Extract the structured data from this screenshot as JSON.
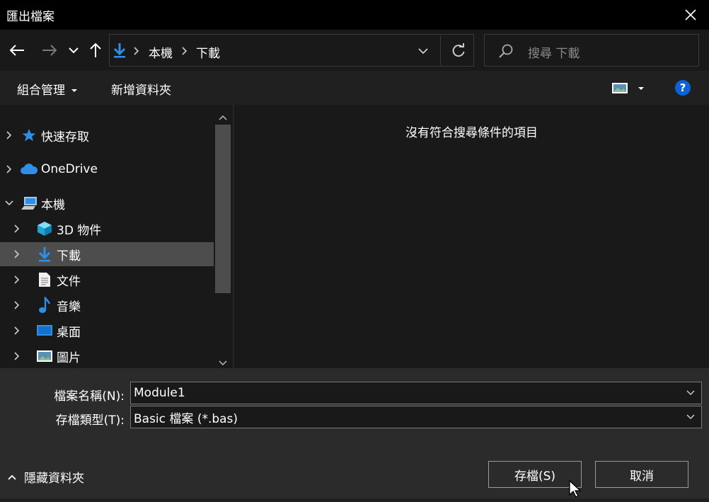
{
  "window": {
    "title": "匯出檔案"
  },
  "address": {
    "crumbs": [
      "本機",
      "下載"
    ]
  },
  "search": {
    "placeholder": "搜尋 下載"
  },
  "toolbar": {
    "organize_label": "組合管理",
    "new_folder_label": "新增資料夾",
    "help_label": "?"
  },
  "nav": {
    "items": [
      {
        "label": "快速存取",
        "icon": "star-icon"
      },
      {
        "label": "OneDrive",
        "icon": "cloud-icon"
      },
      {
        "label": "本機",
        "icon": "computer-icon"
      },
      {
        "label": "3D 物件",
        "icon": "cube-icon"
      },
      {
        "label": "下載",
        "icon": "download-icon",
        "selected": true
      },
      {
        "label": "文件",
        "icon": "document-icon"
      },
      {
        "label": "音樂",
        "icon": "music-icon"
      },
      {
        "label": "桌面",
        "icon": "desktop-icon"
      },
      {
        "label": "圖片",
        "icon": "pictures-icon"
      }
    ]
  },
  "content": {
    "empty_message": "沒有符合搜尋條件的項目"
  },
  "form": {
    "filename_label": "檔案名稱(N):",
    "filename_value": "Module1",
    "filetype_label": "存檔類型(T):",
    "filetype_value": "Basic 檔案 (*.bas)"
  },
  "buttons": {
    "save_label": "存檔(S)",
    "cancel_label": "取消",
    "hide_folders_label": "隱藏資料夾"
  },
  "colors": {
    "accent": "#1e90ff",
    "selected_bg": "#4d4d4d",
    "help_blue": "#0a64d6"
  }
}
